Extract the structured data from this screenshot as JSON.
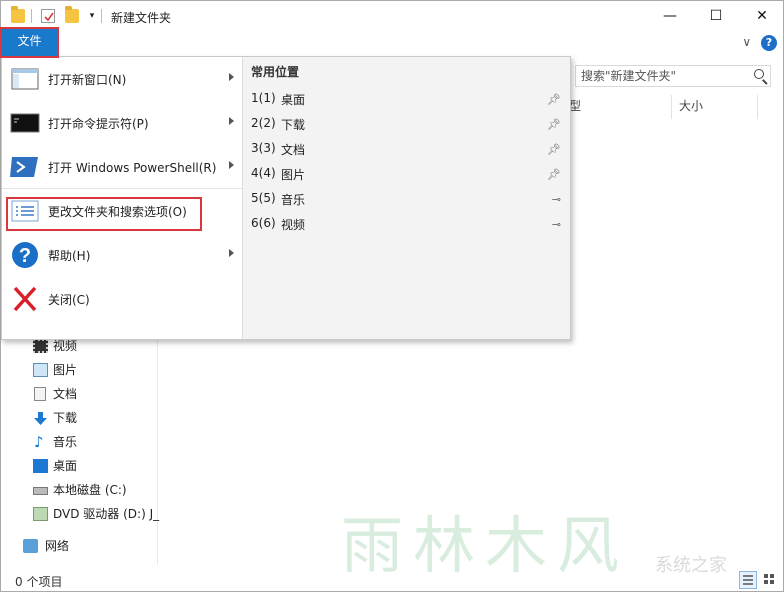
{
  "window": {
    "title": "新建文件夹"
  },
  "caption": {
    "minimize": "—",
    "maximize": "☐",
    "close": "✕"
  },
  "ribbon": {
    "file_tab": "文件",
    "expand": "∨",
    "help": "?"
  },
  "search": {
    "placeholder": "搜索\"新建文件夹\""
  },
  "columns": {
    "type": "型",
    "size": "大小"
  },
  "file_menu": {
    "items": [
      {
        "label": "打开新窗口(N)",
        "icon": "window-icon",
        "submenu": true
      },
      {
        "label": "打开命令提示符(P)",
        "icon": "cmd-icon",
        "submenu": true
      },
      {
        "label": "打开 Windows PowerShell(R)",
        "icon": "powershell-icon",
        "submenu": true
      },
      {
        "label": "更改文件夹和搜索选项(O)",
        "icon": "options-icon",
        "submenu": false
      },
      {
        "label": "帮助(H)",
        "icon": "help-icon",
        "submenu": true
      },
      {
        "label": "关闭(C)",
        "icon": "close-x-icon",
        "submenu": false
      }
    ],
    "recent_title": "常用位置",
    "recent": [
      {
        "num": "1(1)",
        "name": "桌面",
        "pinned": true
      },
      {
        "num": "2(2)",
        "name": "下载",
        "pinned": true
      },
      {
        "num": "3(3)",
        "name": "文档",
        "pinned": true
      },
      {
        "num": "4(4)",
        "name": "图片",
        "pinned": true
      },
      {
        "num": "5(5)",
        "name": "音乐",
        "pinned": false
      },
      {
        "num": "6(6)",
        "name": "视频",
        "pinned": false
      }
    ]
  },
  "nav": {
    "items": [
      {
        "label": "视频",
        "icon": "video-icon"
      },
      {
        "label": "图片",
        "icon": "pictures-icon"
      },
      {
        "label": "文档",
        "icon": "documents-icon"
      },
      {
        "label": "下载",
        "icon": "download-icon"
      },
      {
        "label": "音乐",
        "icon": "music-icon"
      },
      {
        "label": "桌面",
        "icon": "desktop-icon"
      },
      {
        "label": "本地磁盘 (C:)",
        "icon": "drive-icon"
      },
      {
        "label": "DVD 驱动器 (D:) J_",
        "icon": "dvd-icon"
      },
      {
        "label": "网络",
        "icon": "network-icon"
      }
    ]
  },
  "status": {
    "count": "0 个项目"
  },
  "watermark": {
    "main": "雨林木风",
    "sub": "系统之家"
  },
  "colors": {
    "accent": "#1979ca",
    "highlight": "#d9363e"
  }
}
